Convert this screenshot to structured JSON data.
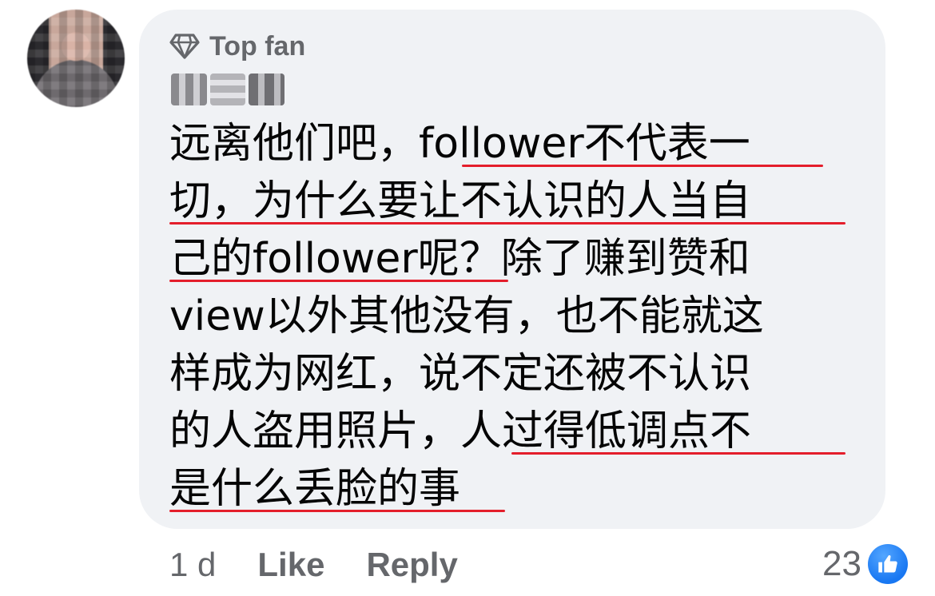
{
  "comment": {
    "badge_icon": "diamond-icon",
    "badge_label": "Top fan",
    "lines": [
      "远离他们吧，follower不代表一",
      "切，为什么要让不认识的人当自",
      "己的follower呢？除了赚到赞和",
      "view以外其他没有，也不能就这",
      "样成为网红，说不定还被不认识",
      "的人盗用照片，人过得低调点不",
      "是什么丢脸的事"
    ]
  },
  "footer": {
    "time": "1 d",
    "like_label": "Like",
    "reply_label": "Reply"
  },
  "reactions": {
    "count": "23",
    "icon": "thumbs-up-icon",
    "color": "#1877f2"
  },
  "colors": {
    "bubble": "#f0f2f5",
    "underline": "#e41e2b",
    "secondary_text": "#65676b"
  }
}
